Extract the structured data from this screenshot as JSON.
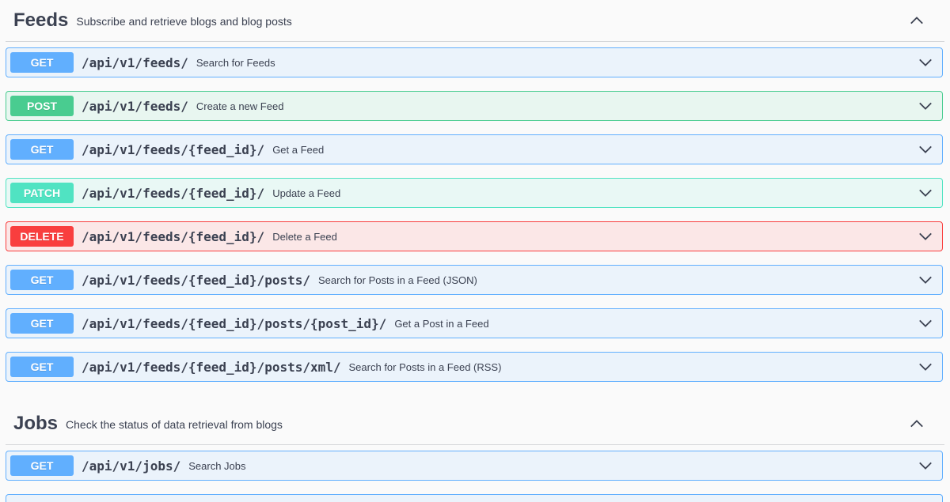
{
  "feeds": {
    "title": "Feeds",
    "description": "Subscribe and retrieve blogs and blog posts",
    "operations": [
      {
        "method": "GET",
        "path": "/api/v1/feeds/",
        "summary": "Search for Feeds"
      },
      {
        "method": "POST",
        "path": "/api/v1/feeds/",
        "summary": "Create a new Feed"
      },
      {
        "method": "GET",
        "path": "/api/v1/feeds/{feed_id}/",
        "summary": "Get a Feed"
      },
      {
        "method": "PATCH",
        "path": "/api/v1/feeds/{feed_id}/",
        "summary": "Update a Feed"
      },
      {
        "method": "DELETE",
        "path": "/api/v1/feeds/{feed_id}/",
        "summary": "Delete a Feed"
      },
      {
        "method": "GET",
        "path": "/api/v1/feeds/{feed_id}/posts/",
        "summary": "Search for Posts in a Feed (JSON)"
      },
      {
        "method": "GET",
        "path": "/api/v1/feeds/{feed_id}/posts/{post_id}/",
        "summary": "Get a Post in a Feed"
      },
      {
        "method": "GET",
        "path": "/api/v1/feeds/{feed_id}/posts/xml/",
        "summary": "Search for Posts in a Feed (RSS)"
      }
    ]
  },
  "jobs": {
    "title": "Jobs",
    "description": "Check the status of data retrieval from blogs",
    "operations": [
      {
        "method": "GET",
        "path": "/api/v1/jobs/",
        "summary": "Search Jobs"
      }
    ]
  },
  "colors": {
    "get": "#61affe",
    "post": "#49cc90",
    "patch": "#50e3c2",
    "delete": "#f93e3e"
  },
  "icons": {
    "collapse": "chevron-up-icon",
    "expand": "chevron-down-icon"
  }
}
